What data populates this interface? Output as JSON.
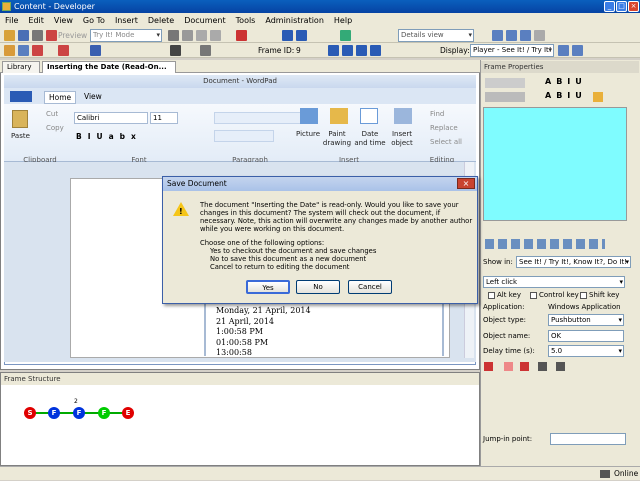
{
  "window": {
    "title": "Content - Developer"
  },
  "menubar": [
    "File",
    "Edit",
    "View",
    "Go To",
    "Insert",
    "Delete",
    "Document",
    "Tools",
    "Administration",
    "Help"
  ],
  "toolbar1": {
    "preview_label": "Preview",
    "mode_select": "Try It! Mode",
    "view_select": "Details view"
  },
  "toolbar2": {
    "frame_label": "Frame ID:",
    "frame_id": "9",
    "display_label": "Display:",
    "display_select": "Player - See It! / Try It!"
  },
  "tabs": [
    {
      "label": "Library"
    },
    {
      "label": "Inserting the Date (Read-On..."
    }
  ],
  "wordpad": {
    "title": "Document - WordPad",
    "ribbon_tabs": [
      "Home",
      "View"
    ],
    "clipboard": {
      "paste": "Paste",
      "cut": "Cut",
      "copy": "Copy",
      "group": "Clipboard"
    },
    "font": {
      "family": "Calibri",
      "size": "11",
      "group": "Font"
    },
    "paragraph_group": "Paragraph",
    "insert": {
      "picture": "Picture",
      "paint": "Paint drawing",
      "datetime": "Date and time",
      "object": "Insert object",
      "group": "Insert"
    },
    "editing": {
      "find": "Find",
      "replace": "Replace",
      "select_all": "Select all",
      "group": "Editing"
    },
    "doc_lines": [
      "Monday, 21 April, 2014",
      "21 April, 2014",
      "1:00:58 PM",
      "01:00:58 PM",
      "13:00:58"
    ]
  },
  "dialog": {
    "title": "Save Document",
    "message": "The document \"Inserting the Date\" is read-only. Would you like to save your changes in this document? The system will check out the document, if necessary. Note, this action will overwrite any changes made by another author while you were working on this document.",
    "options_heading": "Choose one of the following options:",
    "options": [
      "Yes to checkout the document and save changes",
      "No to save this document as a new document",
      "Cancel to return to editing the document"
    ],
    "yes": "Yes",
    "no": "No",
    "cancel": "Cancel"
  },
  "frame_properties": {
    "title": "Frame Properties",
    "show_in_label": "Show in:",
    "show_in_value": "See It! / Try It!, Know It?, Do It!",
    "action_select": "Left click",
    "alt_key": "Alt key",
    "control_key": "Control key",
    "shift_key": "Shift key",
    "application_label": "Application:",
    "application_value": "Windows Application",
    "object_type_label": "Object type:",
    "object_type_value": "Pushbutton",
    "object_name_label": "Object name:",
    "object_name_value": "OK",
    "delay_label": "Delay time (s):",
    "delay_value": "5.0",
    "jump_label": "Jump-in point:"
  },
  "frame_structure": {
    "title": "Frame Structure",
    "nodes": [
      {
        "label": "S",
        "color": "#e00000"
      },
      {
        "label": "F",
        "color": "#0033dd"
      },
      {
        "label": "F",
        "color": "#0033dd"
      },
      {
        "label": "F",
        "color": "#00cc00"
      },
      {
        "label": "E",
        "color": "#e00000"
      }
    ],
    "branch_label": "2"
  },
  "status": {
    "online": "Online"
  }
}
